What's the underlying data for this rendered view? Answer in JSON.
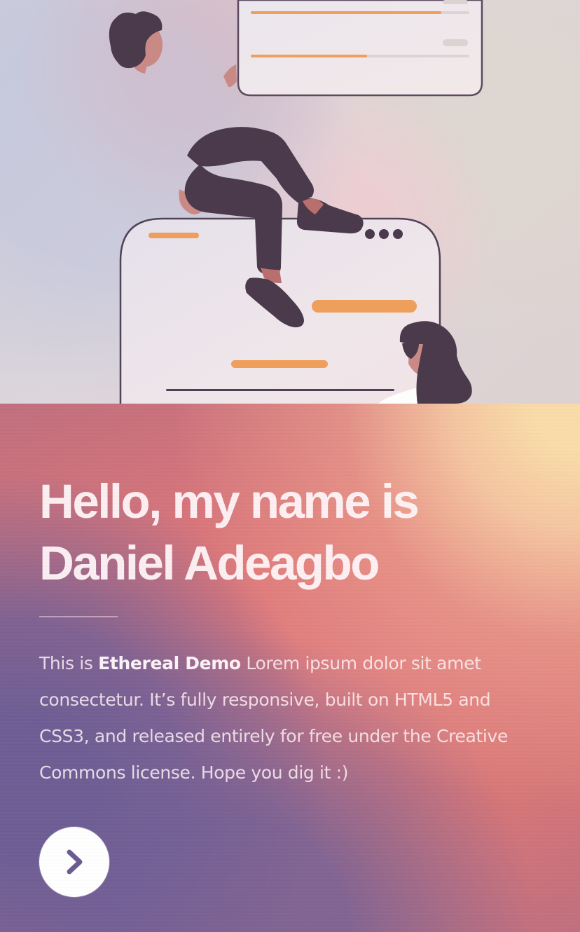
{
  "hero": {
    "heading_line_1": "Hello, my name is",
    "heading_line_2": "Daniel Adeagbo"
  },
  "intro": {
    "prefix": "This is ",
    "brand": "Ethereal Demo",
    "line_1_rest": " Lorem ipsum dolor sit amet",
    "line_2": "consectetur. It’s fully responsive, built on HTML5 and",
    "line_3": "CSS3, and released entirely for free under the Creative",
    "line_4": "Commons license. Hope you dig it :)"
  },
  "actions": {
    "next_button_icon": "chevron-right-icon"
  },
  "colors": {
    "accent_orange": "#ef9f5c",
    "dark_purple": "#4a3a4b",
    "skin": "#c98a86",
    "white": "#ffffff"
  }
}
